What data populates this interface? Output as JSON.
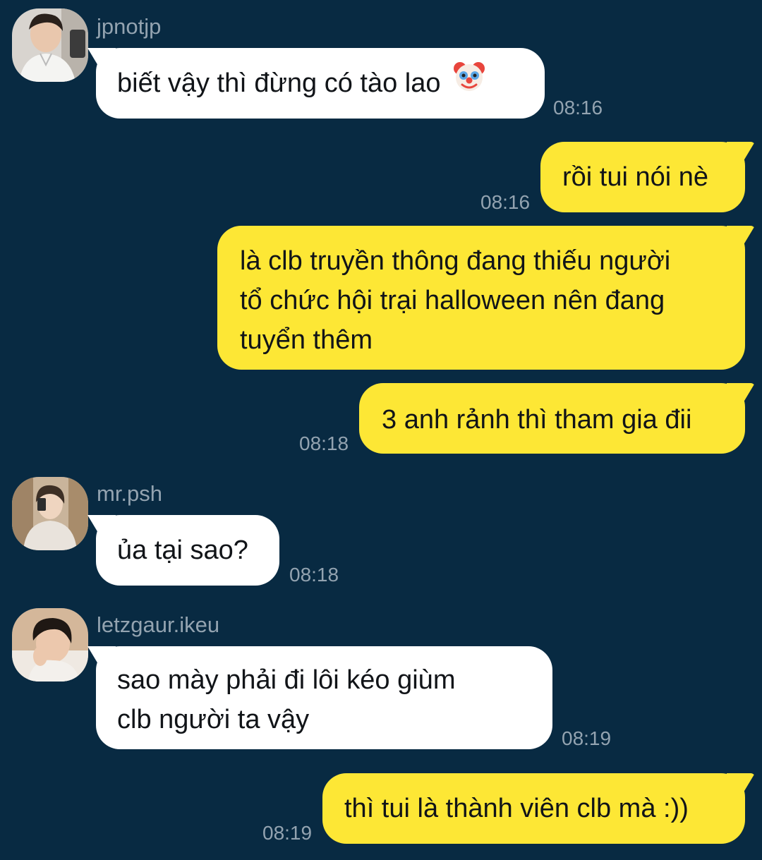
{
  "messages": [
    {
      "sender": "jpnotjp",
      "text": "biết vậy thì đừng có tào lao",
      "emoji": "clown-face-icon",
      "time": "08:16"
    },
    {
      "sender": "",
      "text": "rồi tui nói nè",
      "time": "08:16"
    },
    {
      "sender": "",
      "lines": [
        "là clb truyền thông đang thiếu người",
        "tổ chức hội trại halloween nên đang",
        "tuyển thêm"
      ]
    },
    {
      "sender": "",
      "text": "3 anh rảnh thì tham gia đii",
      "time": "08:18"
    },
    {
      "sender": "mr.psh",
      "text": "ủa tại sao?",
      "time": "08:18"
    },
    {
      "sender": "letzgaur.ikeu",
      "lines": [
        "sao mày phải đi lôi kéo giùm",
        "clb người ta vậy"
      ],
      "time": "08:19"
    },
    {
      "sender": "",
      "text": "thì tui là thành viên clb mà :))",
      "time": "08:19"
    }
  ],
  "colors": {
    "background": "#082a42",
    "incoming_bubble": "#ffffff",
    "outgoing_bubble": "#fde735",
    "meta_text": "#93a3b0"
  }
}
